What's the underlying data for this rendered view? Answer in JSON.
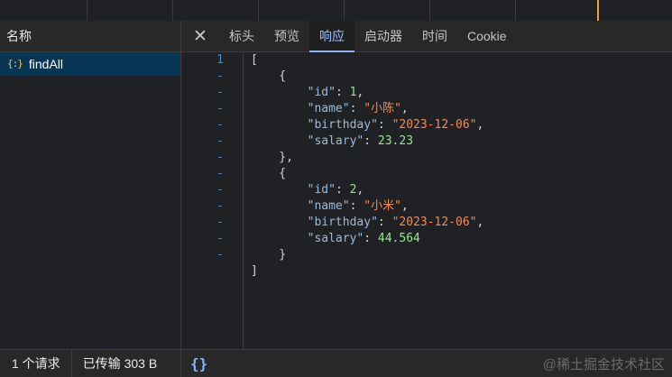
{
  "network": {
    "list_header": "名称",
    "requests": [
      {
        "name": "findAll",
        "icon": "json-icon"
      }
    ]
  },
  "tabs": {
    "close_glyph": "✕",
    "items": [
      "标头",
      "预览",
      "响应",
      "启动器",
      "时间",
      "Cookie"
    ],
    "active": "响应"
  },
  "response": {
    "gutter": [
      "1",
      "-",
      "-",
      "-",
      "-",
      "-",
      "-",
      "-",
      "-",
      "-",
      "-",
      "-",
      "-"
    ],
    "lines": [
      [
        {
          "t": "p",
          "v": "["
        }
      ],
      [
        {
          "t": "p",
          "v": "    {"
        }
      ],
      [
        {
          "t": "p",
          "v": "        "
        },
        {
          "t": "k",
          "v": "\"id\""
        },
        {
          "t": "p",
          "v": ": "
        },
        {
          "t": "n",
          "v": "1"
        },
        {
          "t": "p",
          "v": ","
        }
      ],
      [
        {
          "t": "p",
          "v": "        "
        },
        {
          "t": "k",
          "v": "\"name\""
        },
        {
          "t": "p",
          "v": ": "
        },
        {
          "t": "s",
          "v": "\"小陈\""
        },
        {
          "t": "p",
          "v": ","
        }
      ],
      [
        {
          "t": "p",
          "v": "        "
        },
        {
          "t": "k",
          "v": "\"birthday\""
        },
        {
          "t": "p",
          "v": ": "
        },
        {
          "t": "s",
          "v": "\"2023-12-06\""
        },
        {
          "t": "p",
          "v": ","
        }
      ],
      [
        {
          "t": "p",
          "v": "        "
        },
        {
          "t": "k",
          "v": "\"salary\""
        },
        {
          "t": "p",
          "v": ": "
        },
        {
          "t": "n",
          "v": "23.23"
        }
      ],
      [
        {
          "t": "p",
          "v": "    },"
        }
      ],
      [
        {
          "t": "p",
          "v": "    {"
        }
      ],
      [
        {
          "t": "p",
          "v": "        "
        },
        {
          "t": "k",
          "v": "\"id\""
        },
        {
          "t": "p",
          "v": ": "
        },
        {
          "t": "n",
          "v": "2"
        },
        {
          "t": "p",
          "v": ","
        }
      ],
      [
        {
          "t": "p",
          "v": "        "
        },
        {
          "t": "k",
          "v": "\"name\""
        },
        {
          "t": "p",
          "v": ": "
        },
        {
          "t": "s",
          "v": "\"小米\""
        },
        {
          "t": "p",
          "v": ","
        }
      ],
      [
        {
          "t": "p",
          "v": "        "
        },
        {
          "t": "k",
          "v": "\"birthday\""
        },
        {
          "t": "p",
          "v": ": "
        },
        {
          "t": "s",
          "v": "\"2023-12-06\""
        },
        {
          "t": "p",
          "v": ","
        }
      ],
      [
        {
          "t": "p",
          "v": "        "
        },
        {
          "t": "k",
          "v": "\"salary\""
        },
        {
          "t": "p",
          "v": ": "
        },
        {
          "t": "n",
          "v": "44.564"
        }
      ],
      [
        {
          "t": "p",
          "v": "    }"
        }
      ],
      [
        {
          "t": "p",
          "v": "]"
        }
      ]
    ]
  },
  "status": {
    "requests": "1 个请求",
    "transferred": "已传输 303 B",
    "pretty_print": "{}",
    "watermark": "@稀土掘金技术社区"
  },
  "colors": {
    "key": "#9bbbdc",
    "string": "#f28b54",
    "number": "#9ce39a",
    "active_tab": "#8ab4f8",
    "selected_row": "#073655"
  }
}
